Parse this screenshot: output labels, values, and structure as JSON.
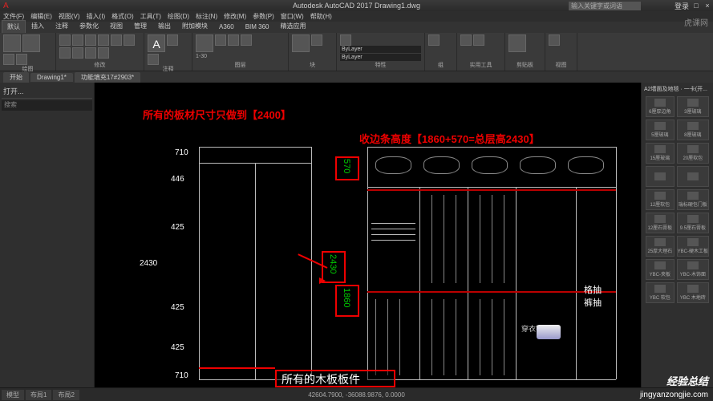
{
  "title_bar": {
    "logo": "A",
    "title": "Autodesk AutoCAD 2017  Drawing1.dwg",
    "search_placeholder": "输入关键字或词语",
    "user": "登录",
    "min": "−",
    "max": "□",
    "close": "×"
  },
  "menu": [
    "文件(F)",
    "编辑(E)",
    "视图(V)",
    "插入(I)",
    "格式(O)",
    "工具(T)",
    "绘图(D)",
    "标注(N)",
    "修改(M)",
    "参数(P)",
    "窗口(W)",
    "帮助(H)"
  ],
  "ribbon_tabs": [
    "默认",
    "插入",
    "注释",
    "参数化",
    "视图",
    "管理",
    "输出",
    "附加模块",
    "A360",
    "BIM 360",
    "精选应用"
  ],
  "ribbon_panels": [
    {
      "name": "绘图",
      "icons": 6
    },
    {
      "name": "修改",
      "icons": 10
    },
    {
      "name": "注释",
      "icons": 4
    },
    {
      "name": "图层",
      "icons": 6
    },
    {
      "name": "块",
      "icons": 3
    },
    {
      "name": "特性",
      "icons": 6,
      "bylayer": "ByLayer",
      "scale": "1-30"
    },
    {
      "name": "组",
      "icons": 2
    },
    {
      "name": "实用工具",
      "icons": 4
    },
    {
      "name": "剪贴板",
      "icons": 3
    },
    {
      "name": "视图",
      "icons": 2
    }
  ],
  "doc_tabs": [
    "开始",
    "Drawing1*",
    "功能填充17#2903*"
  ],
  "left_panel": {
    "title": "打开...",
    "search": "搜索"
  },
  "right_panel": {
    "title": "A2墙面及地毯 · 一卡(开...",
    "swatches": [
      "6厘厚边角",
      "3厘玻璃",
      "5厘玻璃",
      "8厘玻璃",
      "15厘玻璃",
      "20厘软包",
      "",
      "",
      "12厘软包",
      "瑞标硬包门板",
      "12厘石膏板",
      "9.5厘石膏板",
      "25厚大理石",
      "YBC-硬木工板",
      "YBC-夹板",
      "YBC-木饰面",
      "YBC 软包",
      "YBC 木地砖"
    ]
  },
  "annotations": {
    "anno1": "所有的板材尺寸只做到【2400】",
    "anno2": "收边条高度【1860+570=总层高2430】",
    "anno3": "所有的木板板件",
    "text_lattice": "格抽",
    "text_trouser": "裤抽",
    "text_mirror": "穿衣镜"
  },
  "dimensions": {
    "d710a": "710",
    "d446": "446",
    "d425a": "425",
    "d2430": "2430",
    "d425b": "425",
    "d425c": "425",
    "d710b": "710",
    "v570": "570",
    "v2430": "2430",
    "v1860": "1860"
  },
  "status": {
    "tab_model": "模型",
    "tab_layout1": "布局1",
    "tab_layout2": "布局2",
    "coords": "42604.7900, -36088.9876, 0.0000"
  },
  "watermarks": {
    "tl": "虎课网",
    "br": "经验总结",
    "url": "jingyanzongjie.com"
  }
}
